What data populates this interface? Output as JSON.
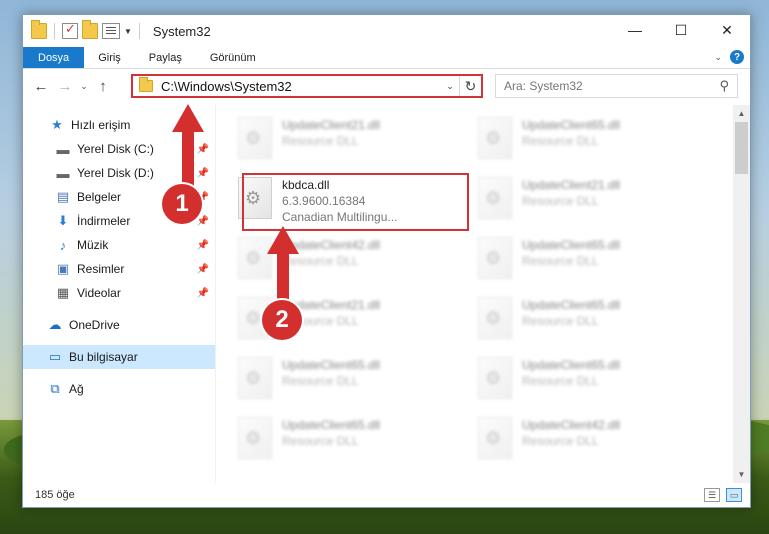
{
  "title": "System32",
  "ribbon": {
    "tabs": [
      "Dosya",
      "Giriş",
      "Paylaş",
      "Görünüm"
    ]
  },
  "address": {
    "path": "C:\\Windows\\System32"
  },
  "search": {
    "placeholder": "Ara: System32"
  },
  "sidebar": {
    "quick_access": "Hızlı erişim",
    "items": [
      {
        "label": "Yerel Disk (C:)",
        "icon": "drive-icon",
        "pinned": true
      },
      {
        "label": "Yerel Disk (D:)",
        "icon": "drive-icon",
        "pinned": true
      },
      {
        "label": "Belgeler",
        "icon": "documents-icon",
        "pinned": true
      },
      {
        "label": "İndirmeler",
        "icon": "download-icon",
        "pinned": true
      },
      {
        "label": "Müzik",
        "icon": "music-icon",
        "pinned": true
      },
      {
        "label": "Resimler",
        "icon": "pictures-icon",
        "pinned": true
      },
      {
        "label": "Videolar",
        "icon": "videos-icon",
        "pinned": true
      }
    ],
    "onedrive": "OneDrive",
    "this_pc": "Bu bilgisayar",
    "network": "Ağ"
  },
  "files": {
    "left": [
      {
        "name": "UpdateClient21.dll",
        "desc": "Resource DLL"
      },
      {
        "name": "kbdca.dll",
        "version": "6.3.9600.16384",
        "desc": "Canadian Multilingu..."
      },
      {
        "name": "UpdateClient42.dll",
        "desc": "Resource DLL"
      },
      {
        "name": "UpdateClient21.dll",
        "desc": "Resource DLL"
      },
      {
        "name": "UpdateClient65.dll",
        "desc": "Resource DLL"
      },
      {
        "name": "UpdateClient65.dll",
        "desc": "Resource DLL"
      }
    ],
    "right": [
      {
        "name": "UpdateClient65.dll",
        "desc": "Resource DLL"
      },
      {
        "name": "UpdateClient21.dll",
        "desc": "Resource DLL"
      },
      {
        "name": "UpdateClient65.dll",
        "desc": "Resource DLL"
      },
      {
        "name": "UpdateClient65.dll",
        "desc": "Resource DLL"
      },
      {
        "name": "UpdateClient65.dll",
        "desc": "Resource DLL"
      },
      {
        "name": "UpdateClient42.dll",
        "desc": "Resource DLL"
      }
    ]
  },
  "status": {
    "count": "185 öğe"
  },
  "annotations": {
    "step1": "1",
    "step2": "2",
    "color": "#d32f2f"
  }
}
